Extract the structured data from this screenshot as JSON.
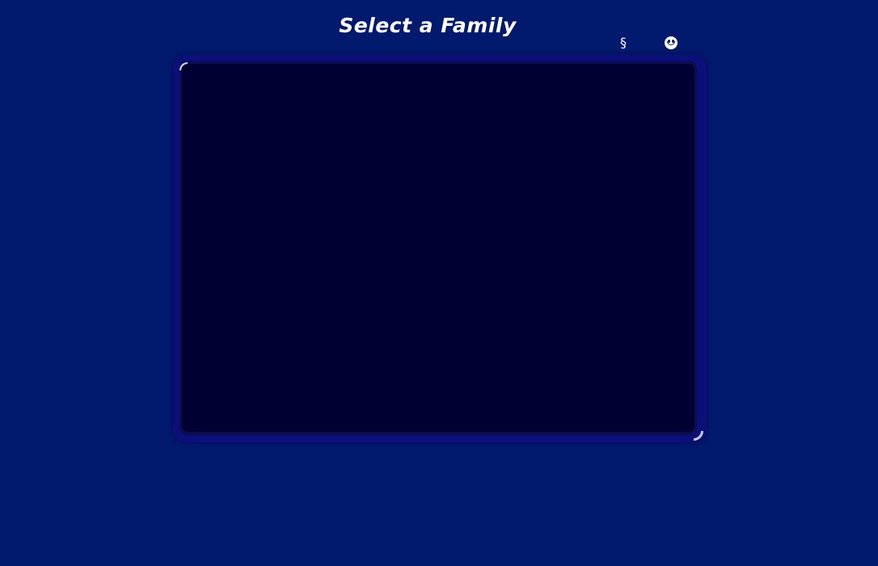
{
  "header": {
    "title": "Select a Family"
  },
  "corner_icons": [
    {
      "name": "section-icon",
      "glyph": "§"
    },
    {
      "name": "smiley-icon",
      "glyph": "☻"
    }
  ],
  "family_list": {
    "items": []
  },
  "colors": {
    "background": "#021a6e",
    "panel_frame": "#0b0f7a",
    "panel_fill": "#000032",
    "text": "#ffffff"
  }
}
